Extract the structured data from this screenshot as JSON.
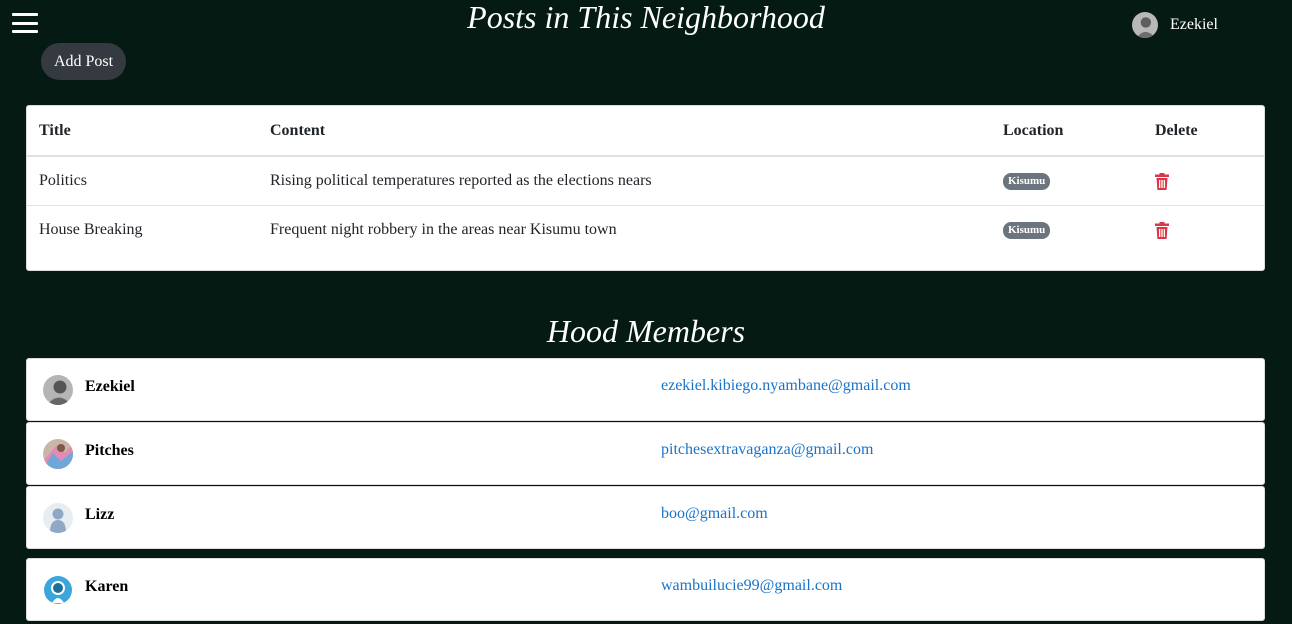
{
  "header": {
    "menu_icon": "hamburger-icon",
    "title": "Posts in This Neighborhood",
    "user_name": "Ezekiel"
  },
  "actions": {
    "add_post_label": "Add Post"
  },
  "posts_table": {
    "columns": [
      "Title",
      "Content",
      "Location",
      "Delete"
    ],
    "rows": [
      {
        "title": "Politics",
        "content": "Rising political temperatures reported as the elections nears",
        "location": "Kisumu",
        "delete_icon": "trash-icon"
      },
      {
        "title": "House Breaking",
        "content": "Frequent night robbery in the areas near Kisumu town",
        "location": "Kisumu",
        "delete_icon": "trash-icon"
      }
    ]
  },
  "members_section": {
    "title": "Hood Members",
    "members": [
      {
        "name": "Ezekiel",
        "email": "ezekiel.kibiego.nyambane@gmail.com"
      },
      {
        "name": "Pitches",
        "email": "pitchesextravaganza@gmail.com"
      },
      {
        "name": "Lizz",
        "email": "boo@gmail.com"
      },
      {
        "name": "Karen",
        "email": "wambuilucie99@gmail.com"
      }
    ]
  },
  "colors": {
    "background": "#061a14",
    "button_bg": "#353a40",
    "badge_bg": "#6c757d",
    "delete_red": "#dc3545",
    "link_blue": "#1a73c8"
  }
}
